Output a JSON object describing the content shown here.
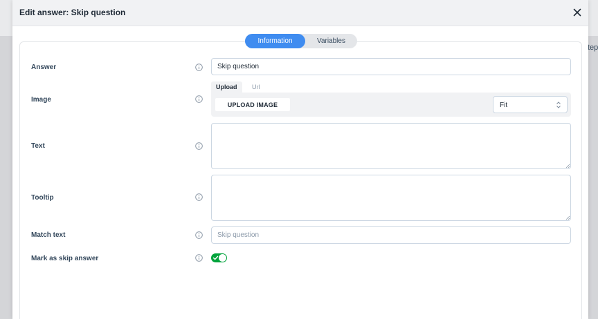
{
  "backdrop": {
    "partial_text": "tep"
  },
  "modal": {
    "title": "Edit answer: Skip question",
    "close_icon": "close-icon"
  },
  "tabs": [
    {
      "label": "Information",
      "active": true
    },
    {
      "label": "Variables",
      "active": false
    }
  ],
  "form": {
    "answer": {
      "label": "Answer",
      "value": "Skip question"
    },
    "image": {
      "label": "Image",
      "tabs": [
        "Upload",
        "Url"
      ],
      "upload_label": "UPLOAD IMAGE",
      "fit_value": "Fit"
    },
    "text": {
      "label": "Text",
      "value": ""
    },
    "tooltip": {
      "label": "Tooltip",
      "value": ""
    },
    "match_text": {
      "label": "Match text",
      "value": "",
      "placeholder": "Skip question"
    },
    "skip_answer": {
      "label": "Mark as skip answer",
      "enabled": true
    }
  },
  "colors": {
    "accent": "#3f8cf0",
    "toggle_on": "#00a33b",
    "text": "#33475b"
  }
}
